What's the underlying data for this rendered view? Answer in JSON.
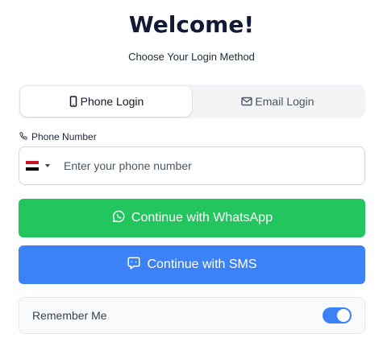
{
  "header": {
    "title": "Welcome!",
    "subtitle": "Choose Your Login Method"
  },
  "tabs": [
    {
      "label": "Phone Login",
      "icon": "smartphone-icon",
      "active": true
    },
    {
      "label": "Email Login",
      "icon": "mail-icon",
      "active": false
    }
  ],
  "phone_field": {
    "label": "Phone Number",
    "label_icon": "phone-icon",
    "country_flag": "egypt-flag-icon",
    "placeholder": "Enter your phone number",
    "value": ""
  },
  "buttons": {
    "whatsapp_label": "Continue with WhatsApp",
    "whatsapp_icon": "whatsapp-icon",
    "sms_label": "Continue with SMS",
    "sms_icon": "message-square-icon"
  },
  "remember": {
    "label": "Remember Me",
    "checked": true
  },
  "colors": {
    "whatsapp": "#22c55e",
    "sms": "#3b82f6",
    "toggle_on": "#3b82f6",
    "title": "#111a35"
  }
}
